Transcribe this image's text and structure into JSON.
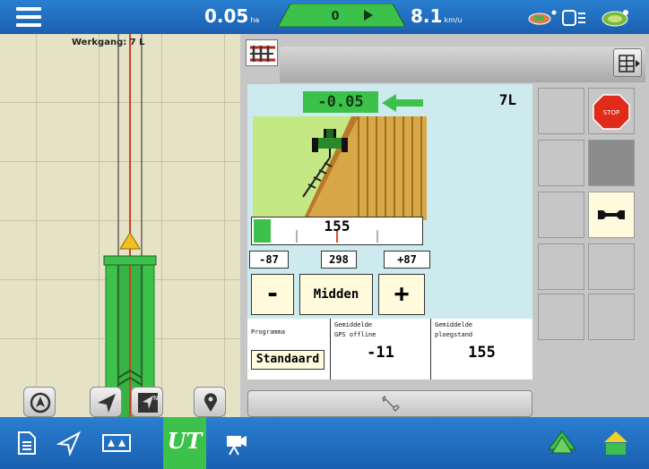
{
  "topbar": {
    "area_value": "0.05",
    "area_unit": "ha",
    "sections_count": "0",
    "speed_value": "8.1",
    "speed_unit": "km/u",
    "icons": [
      "menu-icon",
      "gps-signal-icon",
      "display-status-icon",
      "isobus-icon"
    ]
  },
  "map": {
    "werkgang_label": "Werkgang: 7 L",
    "buttons": [
      "compass-icon",
      "navigate-icon",
      "north-up-icon",
      "location-pin-icon"
    ],
    "colors": {
      "field": "#e6e2c6",
      "swath": "#3cc14a",
      "guidance_line": "#d04020"
    }
  },
  "panel": {
    "tab_icon": "implement-icon",
    "layout_icon": "layout-icon",
    "offset_value": "-0.05",
    "offset_direction": "left-arrow-icon",
    "lane_label": "7L",
    "bar_value": "155",
    "bar_fill_fraction": 0.1,
    "left_value": "-87",
    "center_value": "298",
    "right_value": "+87",
    "minus_label": "-",
    "center_button_label": "Midden",
    "plus_label": "+",
    "info": [
      {
        "label_line1": "Programma",
        "label_line2": "",
        "value": "Standaard"
      },
      {
        "label_line1": "Gemiddelde",
        "label_line2": "GPS offline",
        "value": "-11"
      },
      {
        "label_line1": "Gemiddelde",
        "label_line2": "ploegstand",
        "value": "155"
      }
    ],
    "side_buttons": [
      "",
      "stop-button",
      "",
      "",
      "",
      "wrench-icon",
      "",
      "",
      "",
      ""
    ],
    "stop_label": "STOP",
    "bottom_icon": "wrench-icon"
  },
  "bottombar": {
    "icons": [
      "document-icon",
      "navigation-icon",
      "guidance-icon",
      "ut-icon",
      "camera-icon",
      "field-layers-icon",
      "home-field-icon"
    ],
    "ut_label": "UT",
    "accent": "#3cc14a"
  }
}
